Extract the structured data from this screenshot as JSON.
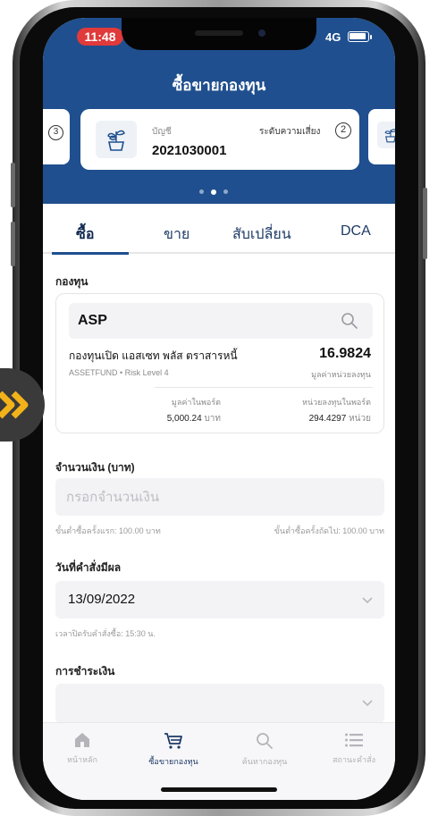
{
  "status_bar": {
    "time": "11:48",
    "network": "4G"
  },
  "header": {
    "title": "ซื้อขายกองทุน"
  },
  "carousel": {
    "prev_risk": "3",
    "main": {
      "account_label": "บัญชี",
      "account_no": "2021030001",
      "risk_label": "ระดับความเสี่ยง",
      "risk_value": "2"
    }
  },
  "tabs": [
    "ซื้อ",
    "ขาย",
    "สับเปลี่ยน",
    "DCA"
  ],
  "fund": {
    "section_label": "กองทุน",
    "code": "ASP",
    "name": "กองทุนเปิด แอสเซท พลัส ตราสารหนี้",
    "nav": "16.9824",
    "sub": "ASSETFUND • Risk Level 4",
    "nav_label": "มูลค่าหน่วยลงทุน",
    "port_value_label": "มูลค่าในพอร์ต",
    "port_value": "5,000.24",
    "port_value_unit": "บาท",
    "port_units_label": "หน่วยลงทุนในพอร์ต",
    "port_units": "294.4297",
    "port_units_unit": "หน่วย"
  },
  "amount": {
    "label": "จำนวนเงิน (บาท)",
    "placeholder": "กรอกจำนวนเงิน",
    "hint_left": "ขั้นต่ำซื้อครั้งแรก: 100.00 บาท",
    "hint_right": "ขั้นต่ำซื้อครั้งถัดไป: 100.00 บาท"
  },
  "effective_date": {
    "label": "วันที่คำสั่งมีผล",
    "value": "13/09/2022",
    "hint": "เวลาปิดรับคำสั่งซื้อ: 15:30 น."
  },
  "payment": {
    "label": "การชำระเงิน"
  },
  "bottom_nav": [
    {
      "label": "หน้าหลัก",
      "icon": "home-icon"
    },
    {
      "label": "ซื้อขายกองทุน",
      "icon": "cart-icon"
    },
    {
      "label": "ค้นหากองทุน",
      "icon": "search-icon"
    },
    {
      "label": "สถานะคำสั่ง",
      "icon": "list-icon"
    }
  ],
  "colors": {
    "primary": "#1f4f8e",
    "time_pill": "#e03a3a",
    "side_badge_arrow": "#f2b21a"
  }
}
